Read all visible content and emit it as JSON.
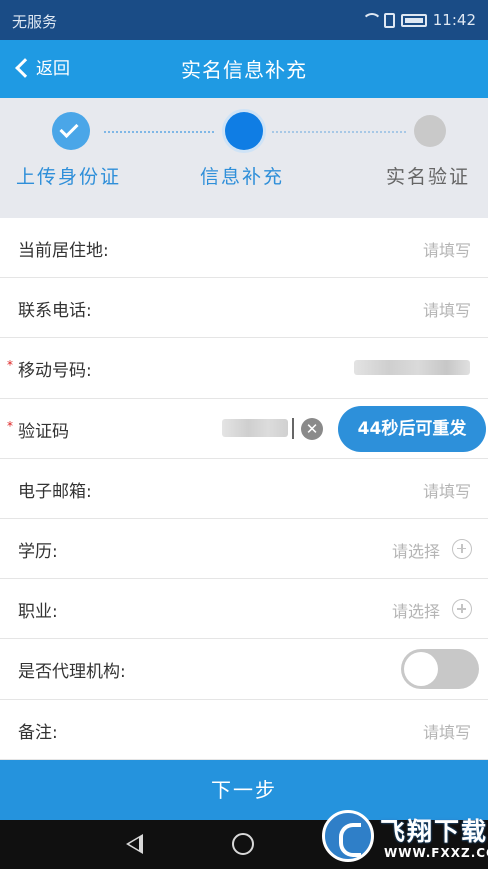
{
  "status_bar": {
    "carrier": "无服务",
    "time": "11:42"
  },
  "header": {
    "back_label": "返回",
    "title": "实名信息补充"
  },
  "steps": [
    {
      "label": "上传身份证",
      "state": "done"
    },
    {
      "label": "信息补充",
      "state": "current"
    },
    {
      "label": "实名验证",
      "state": "pending"
    }
  ],
  "form": {
    "residence": {
      "label": "当前居住地:",
      "placeholder": "请填写"
    },
    "phone": {
      "label": "联系电话:",
      "placeholder": "请填写"
    },
    "mobile": {
      "label": "移动号码:",
      "required_mark": "*"
    },
    "code": {
      "label": "验证码",
      "required_mark": "*",
      "resend_label": "44秒后可重发",
      "clear_glyph": "✕"
    },
    "email": {
      "label": "电子邮箱:",
      "placeholder": "请填写"
    },
    "education": {
      "label": "学历:",
      "placeholder": "请选择"
    },
    "occupation": {
      "label": "职业:",
      "placeholder": "请选择"
    },
    "agency": {
      "label": "是否代理机构:",
      "toggle_on": false
    },
    "remarks": {
      "label": "备注:",
      "placeholder": "请填写"
    }
  },
  "next_button": "下一步",
  "watermark": {
    "name": "飞翔下载",
    "url": "WWW.FXXZ.COM"
  },
  "colors": {
    "status_bar": "#1a4c86",
    "app_bar": "#1f9ae3",
    "accent": "#2d90da",
    "required": "#dd2222"
  }
}
